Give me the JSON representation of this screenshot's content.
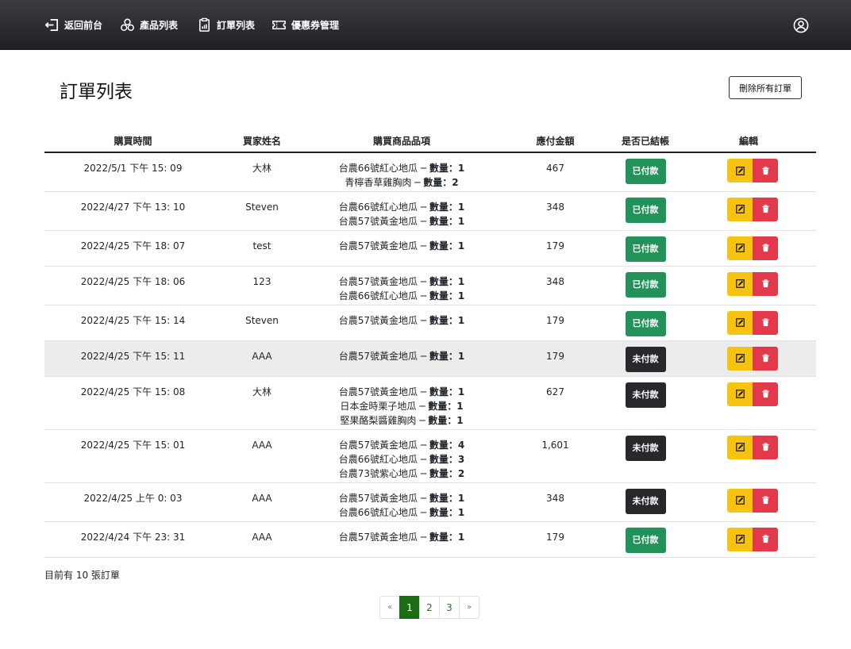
{
  "nav": {
    "items": [
      {
        "label": "返回前台",
        "icon": "exit-icon"
      },
      {
        "label": "產品列表",
        "icon": "products-icon"
      },
      {
        "label": "訂單列表",
        "icon": "orders-icon"
      },
      {
        "label": "優惠券管理",
        "icon": "coupon-icon"
      }
    ],
    "user_icon": "user-icon"
  },
  "page": {
    "title": "訂單列表",
    "delete_all_label": "刪除所有訂單"
  },
  "table": {
    "headers": [
      "購買時間",
      "買家姓名",
      "購買商品品項",
      "應付金額",
      "是否已結帳",
      "編輯"
    ],
    "qty_label": "數量：",
    "separator": " ─ ",
    "rows": [
      {
        "time": "2022/5/1 下午 15: 09",
        "name": "大林",
        "items": [
          {
            "product": "台農66號紅心地瓜",
            "qty": "1"
          },
          {
            "product": "青檸香草雞胸肉",
            "qty": "2"
          }
        ],
        "amount": "467",
        "status": "已付款",
        "paid": true
      },
      {
        "time": "2022/4/27 下午 13: 10",
        "name": "Steven",
        "items": [
          {
            "product": "台農66號紅心地瓜",
            "qty": "1"
          },
          {
            "product": "台農57號黃金地瓜",
            "qty": "1"
          }
        ],
        "amount": "348",
        "status": "已付款",
        "paid": true
      },
      {
        "time": "2022/4/25 下午 18: 07",
        "name": "test",
        "items": [
          {
            "product": "台農57號黃金地瓜",
            "qty": "1"
          }
        ],
        "amount": "179",
        "status": "已付款",
        "paid": true
      },
      {
        "time": "2022/4/25 下午 18: 06",
        "name": "123",
        "items": [
          {
            "product": "台農57號黃金地瓜",
            "qty": "1"
          },
          {
            "product": "台農66號紅心地瓜",
            "qty": "1"
          }
        ],
        "amount": "348",
        "status": "已付款",
        "paid": true
      },
      {
        "time": "2022/4/25 下午 15: 14",
        "name": "Steven",
        "items": [
          {
            "product": "台農57號黃金地瓜",
            "qty": "1"
          }
        ],
        "amount": "179",
        "status": "已付款",
        "paid": true
      },
      {
        "time": "2022/4/25 下午 15: 11",
        "name": "AAA",
        "items": [
          {
            "product": "台農57號黃金地瓜",
            "qty": "1"
          }
        ],
        "amount": "179",
        "status": "未付款",
        "paid": false
      },
      {
        "time": "2022/4/25 下午 15: 08",
        "name": "大林",
        "items": [
          {
            "product": "台農57號黃金地瓜",
            "qty": "1"
          },
          {
            "product": "日本金時栗子地瓜",
            "qty": "1"
          },
          {
            "product": "堅果酪梨醬雞胸肉",
            "qty": "1"
          }
        ],
        "amount": "627",
        "status": "未付款",
        "paid": false
      },
      {
        "time": "2022/4/25 下午 15: 01",
        "name": "AAA",
        "items": [
          {
            "product": "台農57號黃金地瓜",
            "qty": "4"
          },
          {
            "product": "台農66號紅心地瓜",
            "qty": "3"
          },
          {
            "product": "台農73號紫心地瓜",
            "qty": "2"
          }
        ],
        "amount": "1,601",
        "status": "未付款",
        "paid": false
      },
      {
        "time": "2022/4/25 上午 0: 03",
        "name": "AAA",
        "items": [
          {
            "product": "台農57號黃金地瓜",
            "qty": "1"
          },
          {
            "product": "台農66號紅心地瓜",
            "qty": "1"
          }
        ],
        "amount": "348",
        "status": "未付款",
        "paid": false
      },
      {
        "time": "2022/4/24 下午 23: 31",
        "name": "AAA",
        "items": [
          {
            "product": "台農57號黃金地瓜",
            "qty": "1"
          }
        ],
        "amount": "179",
        "status": "已付款",
        "paid": true
      }
    ]
  },
  "footer": {
    "order_count_text": "目前有 10 張訂單"
  },
  "pagination": {
    "prev": "«",
    "pages": [
      "1",
      "2",
      "3"
    ],
    "active_page": "1",
    "next": "»"
  },
  "colors": {
    "navbar": "#2b2d30",
    "paid": "#22915a",
    "unpaid": "#26282b",
    "edit": "#f7c312",
    "delete": "#e2394b",
    "page_active": "#1b6d14"
  }
}
